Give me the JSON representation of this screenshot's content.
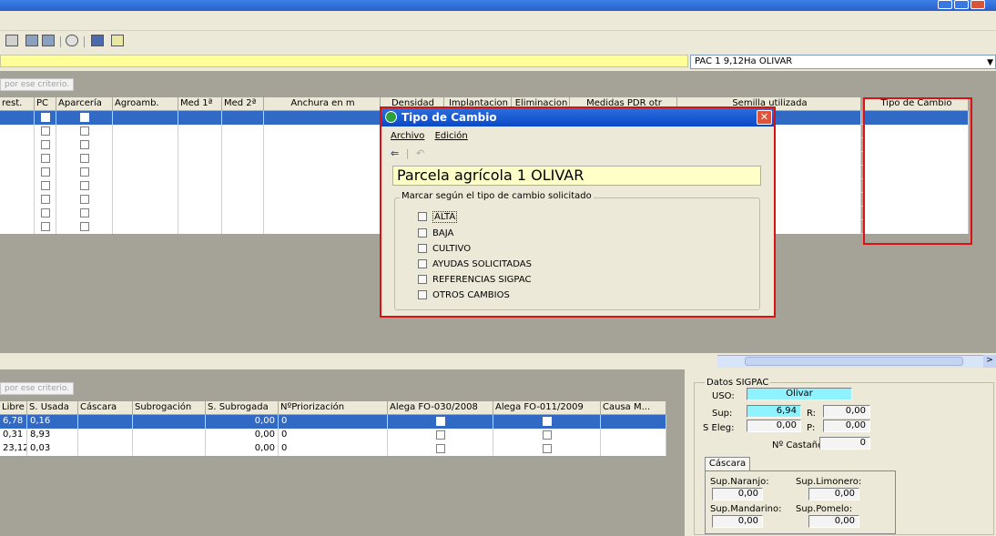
{
  "window": {
    "colors": {
      "title": "#2a5fc8",
      "selection": "#316ac5",
      "highlight": "#d11111",
      "criteria": "#ffff9a"
    }
  },
  "toolbar": {
    "icons": [
      "save-icon",
      "grid-icon",
      "table-icon",
      "pie-icon",
      "card-icon",
      "edit-icon"
    ]
  },
  "combo": {
    "value": "PAC 1 9,12Ha OLIVAR"
  },
  "upper_grid": {
    "hint": "por ese criterio.",
    "columns": [
      "rest.",
      "PC",
      "Aparcería",
      "Agroamb.",
      "Med 1ª",
      "Med 2ª",
      "Anchura en m",
      "Densidad",
      "Implantacion",
      "Eliminacion",
      "Medidas PDR otr",
      "Semilla utilizada",
      "Tipo de Cambio"
    ],
    "row_count": 9
  },
  "dialog": {
    "title": "Tipo de Cambio",
    "menu": [
      "Archivo",
      "Edición"
    ],
    "parcel": "Parcela agrícola 1   OLIVAR",
    "group_label": "Marcar según el tipo de cambio solicitado",
    "options": [
      "ALTA",
      "BAJA",
      "CULTIVO",
      "AYUDAS SOLICITADAS",
      "REFERENCIAS SIGPAC",
      "OTROS CAMBIOS"
    ]
  },
  "lower_grid": {
    "hint": "por ese criterio.",
    "columns": [
      "Libre",
      "S. Usada",
      "Cáscara",
      "Subrogación",
      "S. Subrogada",
      "NºPriorización",
      "Alega FO-030/2008",
      "Alega FO-011/2009",
      "Causa M..."
    ],
    "rows": [
      {
        "libre": "6,78",
        "usada": "0,16",
        "subrogada": "0,00",
        "prior": "0"
      },
      {
        "libre": "0,31",
        "usada": "8,93",
        "subrogada": "0,00",
        "prior": "0"
      },
      {
        "libre": "23,12",
        "usada": "0,03",
        "subrogada": "0,00",
        "prior": "0"
      }
    ]
  },
  "sigpac": {
    "title": "Datos SIGPAC",
    "uso_label": "USO:",
    "uso": "Olivar",
    "sup_label": "Sup:",
    "sup": "6,94",
    "r_label": "R:",
    "r": "0,00",
    "seleg_label": "S Eleg:",
    "seleg": "0,00",
    "p_label": "P:",
    "p": "0,00",
    "castanos_label": "Nº Castaños",
    "castanos": "0",
    "tab": "Cáscara",
    "naranjo_label": "Sup.Naranjo:",
    "naranjo": "0,00",
    "limonero_label": "Sup.Limonero:",
    "limonero": "0,00",
    "mandarino_label": "Sup.Mandarino:",
    "mandarino": "0,00",
    "pomelo_label": "Sup.Pomelo:",
    "pomelo": "0,00"
  }
}
